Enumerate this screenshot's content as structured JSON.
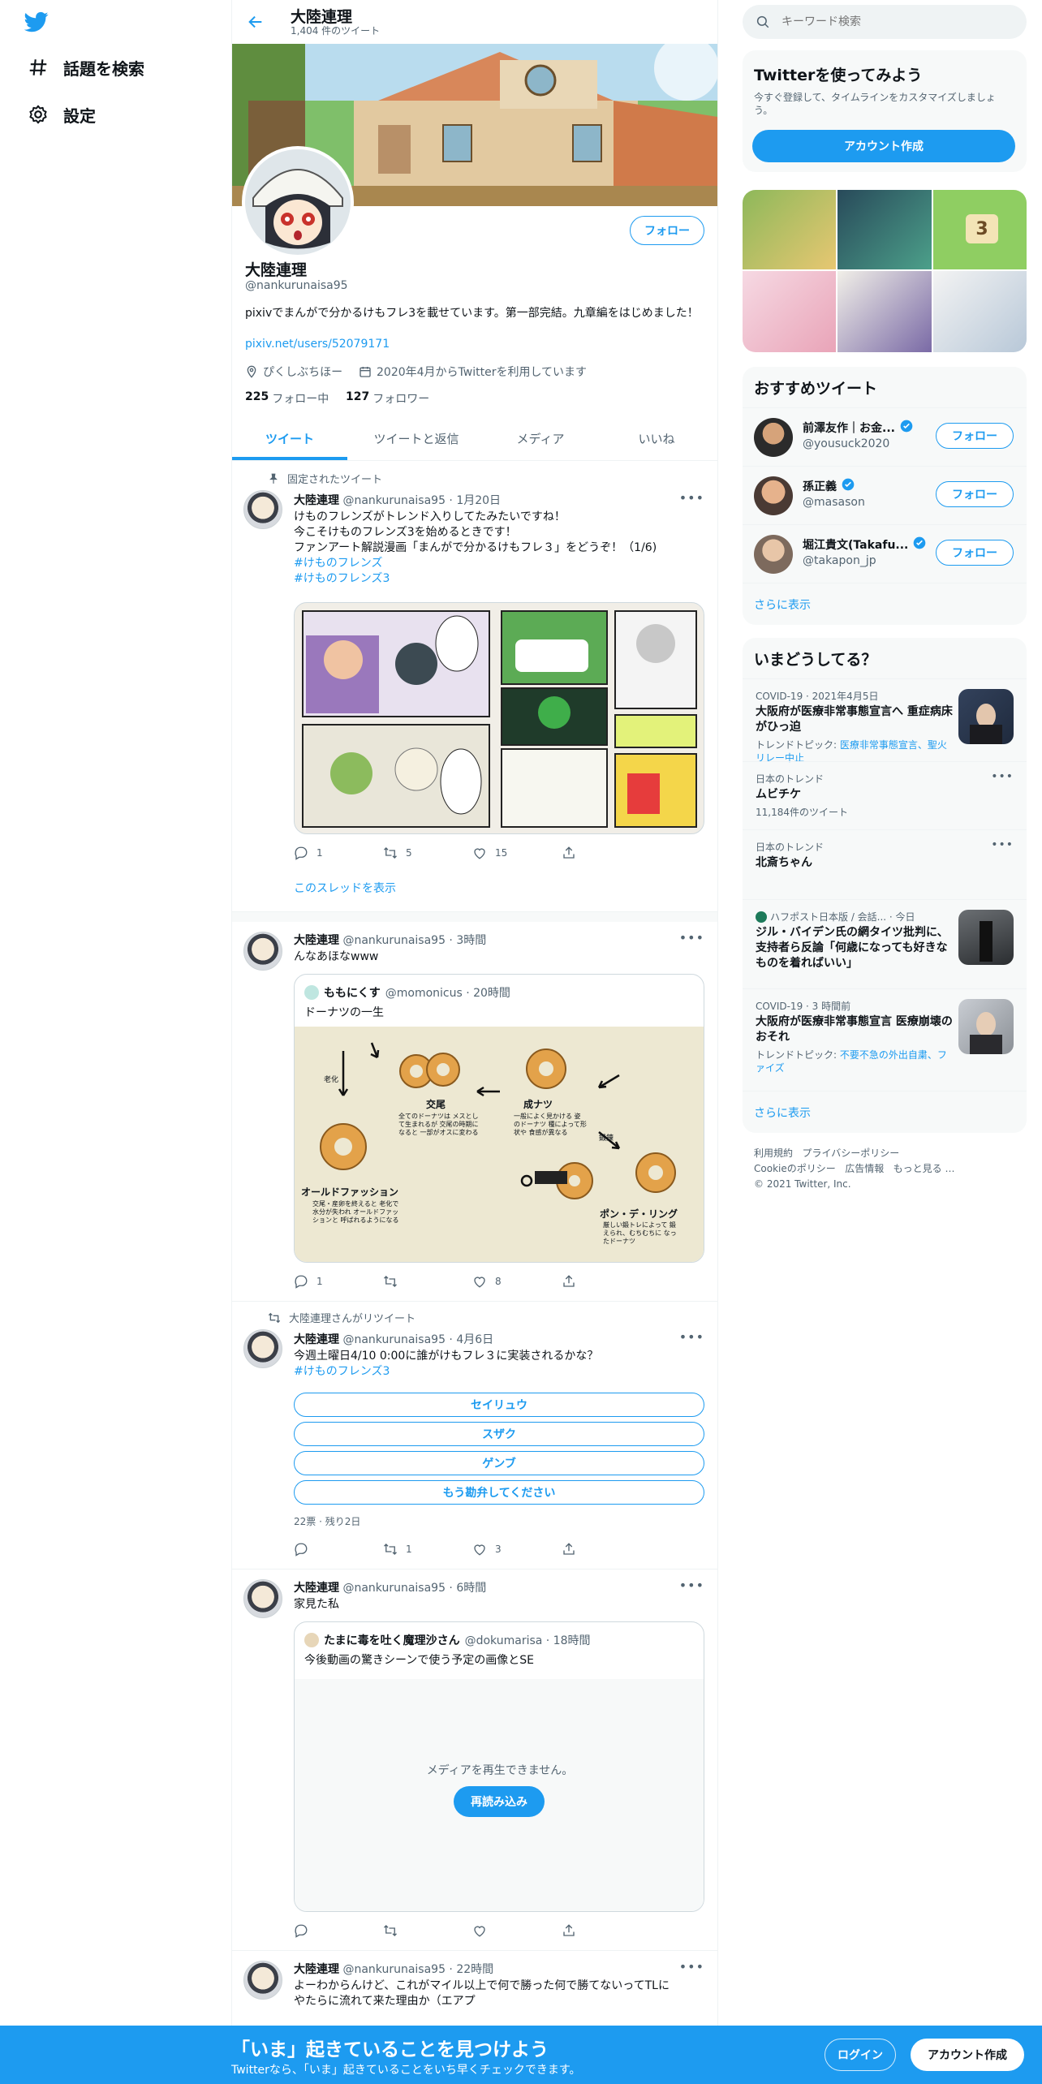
{
  "nav": {
    "explore": "話題を検索",
    "settings": "設定"
  },
  "header": {
    "name": "大陸連理",
    "tweet_count": "1,404 件のツイート"
  },
  "profile": {
    "name": "大陸連理",
    "handle": "@nankurunaisa95",
    "bio": "pixivでまんがで分かるけもフレ3を載せています。第一部完結。九章編をはじめました！",
    "link": "pixiv.net/users/52079171",
    "location": "ぴくしぶちほー",
    "joined": "2020年4月からTwitterを利用しています",
    "following_count": "225",
    "following_label": "フォロー中",
    "followers_count": "127",
    "followers_label": "フォロワー",
    "follow_button": "フォロー"
  },
  "tabs": [
    "ツイート",
    "ツイートと返信",
    "メディア",
    "いいね"
  ],
  "tweets": {
    "t1": {
      "pinned": "固定されたツイート",
      "name": "大陸連理",
      "meta": "@nankurunaisa95 · 1月20日",
      "line1": "けものフレンズがトレンド入りしてたみたいですね！",
      "line2": "今こそけものフレンズ3を始めるときです！",
      "line3": "ファンアート解説漫画「まんがで分かるけもフレ３」をどうぞ！（1/6)",
      "tag1": "#けものフレンズ",
      "tag2": "#けものフレンズ3",
      "replies": "1",
      "retweets": "5",
      "likes": "15",
      "thread": "このスレッドを表示"
    },
    "t2": {
      "name": "大陸連理",
      "meta": "@nankurunaisa95 · 3時間",
      "text": "んなあほなwww",
      "q_name": "ももにくす",
      "q_meta": "@momonicus · 20時間",
      "q_text": "ドーナツの一生",
      "d1": "交尾",
      "d2": "成ナツ",
      "d3": "オールドファッション",
      "d4": "ポン・デ・リング",
      "d5": "老化",
      "d6": "鍛錬",
      "d7": "全てのドーナツは メスとして生まれるが 交尾の時期になると 一部がオスに変わる",
      "d8": "一般によく見かける 姿のドーナツ 種によって形状や 食感が異なる",
      "d9": "交尾・産卵を終えると 老化で水分が失われ オールドファッションと 呼ばれるようになる",
      "d10": "厳しい鍛トレによって 鍛えられ、むちむちに なったドーナツ",
      "replies": "1",
      "likes": "8"
    },
    "t3": {
      "rt_by": "大陸連理さんがリツイート",
      "name": "大陸連理",
      "meta": "@nankurunaisa95 · 4月6日",
      "text": "今週土曜日4/10 0:00に誰がけもフレ３に実装されるかな？",
      "tag": "#けものフレンズ3",
      "options": [
        "セイリュウ",
        "スザク",
        "ゲンブ",
        "もう勘弁してください"
      ],
      "poll_meta": "22票 · 残り2日",
      "retweets": "1",
      "likes": "3"
    },
    "t4": {
      "name": "大陸連理",
      "meta": "@nankurunaisa95 · 6時間",
      "text": "家見た私",
      "q_name": "たまに毒を吐く魔理沙さん",
      "q_meta": "@dokumarisa · 18時間",
      "q_text": "今後動画の驚きシーンで使う予定の画像とSE",
      "media_error": "メディアを再生できません。",
      "reload": "再読み込み"
    },
    "t5": {
      "name": "大陸連理",
      "meta": "@nankurunaisa95 · 22時間",
      "line1": "よーわからんけど、これがマイル以上で何で勝った何で勝てないってTLに",
      "line2": "やたらに流れて来た理由か（エアプ"
    }
  },
  "search": {
    "placeholder": "キーワード検索"
  },
  "signup": {
    "title": "Twitterを使ってみよう",
    "text": "今すぐ登録して、タイムラインをカスタマイズしましょう。",
    "button": "アカウント作成"
  },
  "recommend": {
    "title": "おすすめツイート",
    "users": [
      {
        "name": "前澤友作｜お金...",
        "handle": "@yousuck2020",
        "follow": "フォロー"
      },
      {
        "name": "孫正義",
        "handle": "@masason",
        "follow": "フォロー"
      },
      {
        "name": "堀江貴文(Takafu...",
        "handle": "@takapon_jp",
        "follow": "フォロー"
      }
    ],
    "more": "さらに表示"
  },
  "trends": {
    "title": "いまどうしてる？",
    "items": [
      {
        "meta": "COVID-19 · 2021年4月5日",
        "title": "大阪府が医療非常事態宣言へ 重症病床がひっ迫",
        "sub_label": "トレンドトピック: ",
        "sub_links": "医療非常事態宣言、聖火リレー中止"
      },
      {
        "meta": "日本のトレンド",
        "title": "ムビチケ",
        "count": "11,184件のツイート"
      },
      {
        "meta": "日本のトレンド",
        "title": "北斎ちゃん"
      },
      {
        "meta": "ハフポスト日本版 / 会話... · 今日",
        "title": "ジル・バイデン氏の網タイツ批判に、支持者ら反論「何歳になっても好きなものを着ればいい」"
      },
      {
        "meta": "COVID-19 · 3 時間前",
        "title": "大阪府が医療非常事態宣言 医療崩壊のおそれ",
        "sub_label": "トレンドトピック: ",
        "sub_links": "不要不急の外出自粛、ファイズ"
      }
    ],
    "more": "さらに表示"
  },
  "footer": {
    "l1": "利用規約",
    "l2": "プライバシーポリシー",
    "l3": "Cookieのポリシー",
    "l4": "広告情報",
    "l5": "もっと見る …",
    "copy": "© 2021 Twitter, Inc."
  },
  "banner": {
    "title": "「いま」起きていることを見つけよう",
    "text": "Twitterなら、「いま」起きていることをいち早くチェックできます。",
    "login": "ログイン",
    "signup": "アカウント作成"
  },
  "colors": {
    "accent": "#1d9bf0",
    "text": "#0f1419",
    "muted": "#536471",
    "panel": "#f7f9f9"
  }
}
